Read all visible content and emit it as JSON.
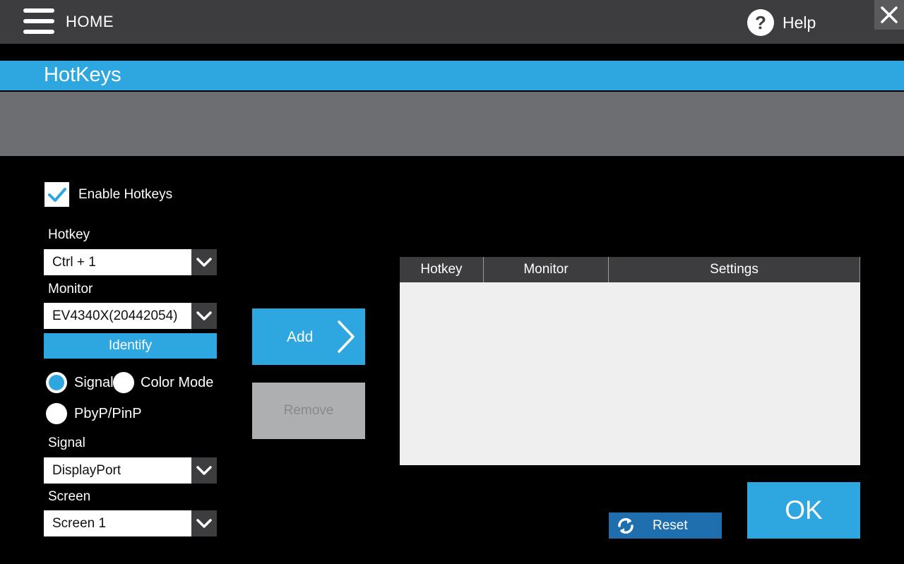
{
  "header": {
    "home_label": "HOME",
    "help_label": "Help",
    "help_icon_glyph": "?",
    "icons": {
      "menu": "hamburger-menu-icon",
      "help": "question-circle-icon",
      "close": "close-icon"
    }
  },
  "page": {
    "title": "HotKeys"
  },
  "form": {
    "enable_hotkeys": {
      "label": "Enable Hotkeys",
      "checked": true
    },
    "hotkey": {
      "label": "Hotkey",
      "value": "Ctrl + 1"
    },
    "monitor": {
      "label": "Monitor",
      "value": "EV4340X(20442054)"
    },
    "identify_label": "Identify",
    "radios": [
      {
        "label": "Signal",
        "selected": true
      },
      {
        "label": "Color Mode",
        "selected": false
      },
      {
        "label": "PbyP/PinP",
        "selected": false
      }
    ],
    "signal": {
      "label": "Signal",
      "value": "DisplayPort"
    },
    "screen": {
      "label": "Screen",
      "value": "Screen 1"
    }
  },
  "actions": {
    "add_label": "Add",
    "remove_label": "Remove",
    "reset_label": "Reset",
    "ok_label": "OK"
  },
  "table": {
    "columns": [
      "Hotkey",
      "Monitor",
      "Settings"
    ],
    "rows": []
  },
  "colors": {
    "accent": "#2ea6e0",
    "topbar": "#3d3d3f",
    "grey_band": "#6d6e71",
    "reset": "#1f6fae",
    "disabled": "#aeafb1"
  }
}
